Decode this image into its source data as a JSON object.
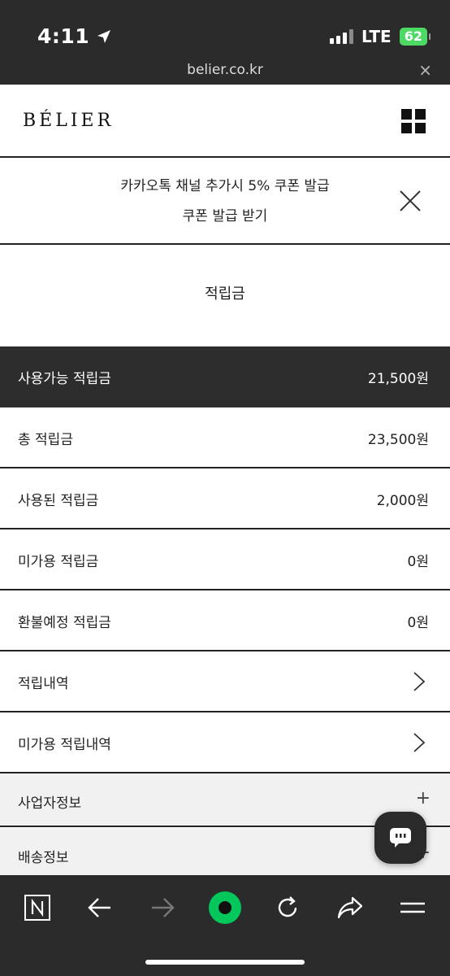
{
  "status_bar": {
    "time": "4:11",
    "network": "LTE",
    "battery": "62"
  },
  "browser": {
    "url": "belier.co.kr",
    "close_label": "×"
  },
  "header": {
    "logo": "BÉLIER",
    "menu_icon": "grid-menu-icon"
  },
  "banner": {
    "line1": "카카오톡 채널 추가시 5% 쿠폰 발급",
    "line2": "쿠폰 발급 받기",
    "close_icon": "close-icon"
  },
  "page": {
    "title": "적립금"
  },
  "points": [
    {
      "label": "사용가능 적립금",
      "value": "21,500원"
    },
    {
      "label": "총 적립금",
      "value": "23,500원"
    },
    {
      "label": "사용된 적립금",
      "value": "2,000원"
    },
    {
      "label": "미가용 적립금",
      "value": "0원"
    },
    {
      "label": "환불예정 적립금",
      "value": "0원"
    }
  ],
  "links": [
    {
      "label": "적립내역"
    },
    {
      "label": "미가용 적립내역"
    }
  ],
  "accordions": [
    {
      "label": "사업자정보",
      "icon": "+"
    },
    {
      "label": "배송정보",
      "icon": "+"
    }
  ],
  "toolbar": {
    "items": [
      "naver-icon",
      "back-icon",
      "forward-icon",
      "green-dot-icon",
      "reload-icon",
      "share-icon",
      "menu-icon"
    ]
  },
  "colors": {
    "dark": "#2b2b2b",
    "accent": "#03c75a",
    "battery": "#4cd964"
  }
}
